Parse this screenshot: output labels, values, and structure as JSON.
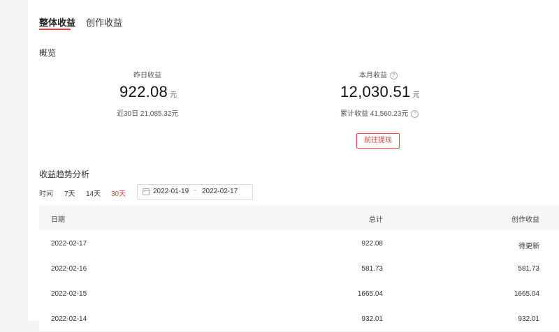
{
  "tabs": [
    {
      "label": "整体收益",
      "active": true
    },
    {
      "label": "创作收益",
      "active": false
    }
  ],
  "overview": {
    "title": "概览",
    "yesterday": {
      "label": "昨日收益",
      "value": "922.08",
      "unit": "元",
      "sub": "近30日 21,085.32元"
    },
    "month": {
      "label": "本月收益",
      "value": "12,030.51",
      "unit": "元",
      "sub": "累计收益 41,560.23元"
    },
    "withdraw_label": "前往提现",
    "help_glyph": "?"
  },
  "trend": {
    "title": "收益趋势分析",
    "range_label": "时间",
    "ranges": [
      {
        "label": "7天",
        "active": false
      },
      {
        "label": "14天",
        "active": false
      },
      {
        "label": "30天",
        "active": true
      }
    ],
    "date_start": "2022-01-19",
    "date_sep": "~",
    "date_end": "2022-02-17"
  },
  "table": {
    "columns": [
      "日期",
      "总计",
      "创作收益"
    ],
    "rows": [
      [
        "2022-02-17",
        "922.08",
        "待更新"
      ],
      [
        "2022-02-16",
        "581.73",
        "581.73"
      ],
      [
        "2022-02-15",
        "1665.04",
        "1665.04"
      ],
      [
        "2022-02-14",
        "932.01",
        "932.01"
      ]
    ]
  },
  "colors": {
    "accent": "#f04142"
  }
}
